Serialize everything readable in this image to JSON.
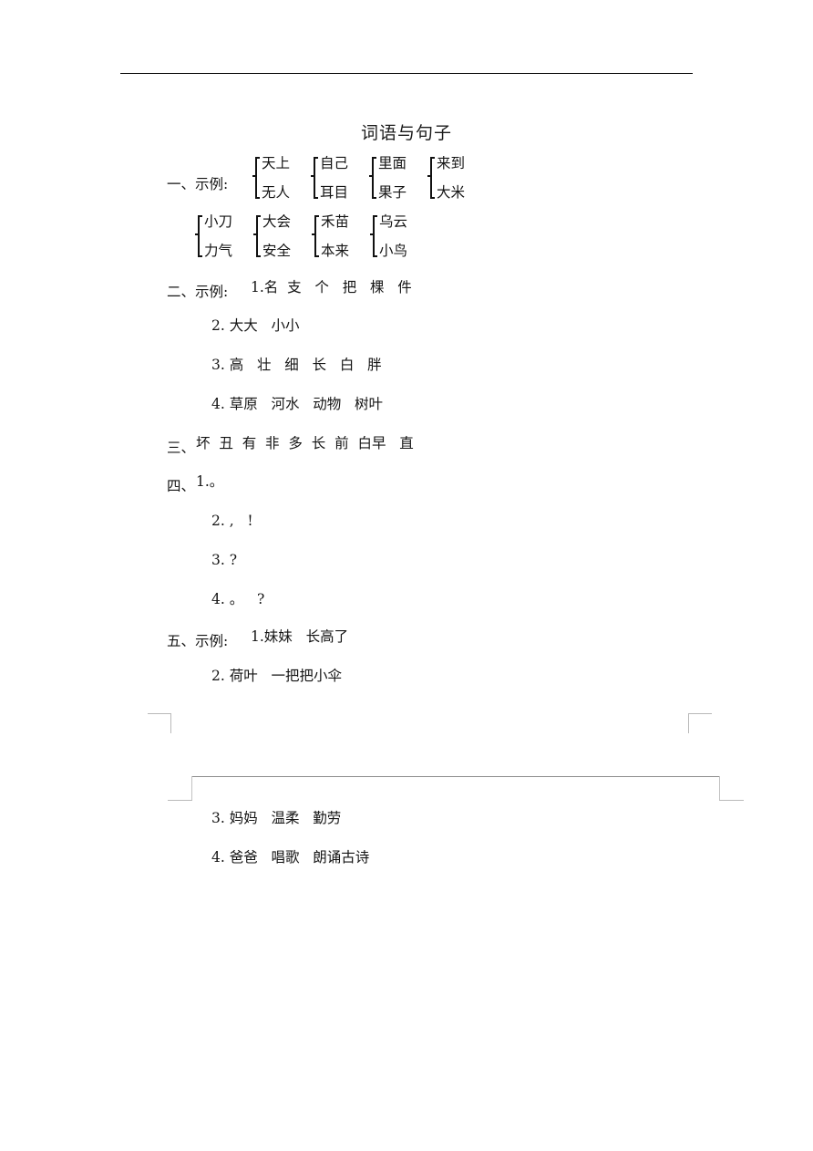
{
  "document": {
    "title": "词语与句子"
  },
  "sections": {
    "one": {
      "label": "一、示例:",
      "row1": [
        {
          "top": "天上",
          "bottom": "无人"
        },
        {
          "top": "自己",
          "bottom": "耳目"
        },
        {
          "top": "里面",
          "bottom": "果子"
        },
        {
          "top": "来到",
          "bottom": "大米"
        }
      ],
      "row2": [
        {
          "top": "小刀",
          "bottom": "力气"
        },
        {
          "top": "大会",
          "bottom": "安全"
        },
        {
          "top": "禾苗",
          "bottom": "本来"
        },
        {
          "top": "乌云",
          "bottom": "小鸟"
        }
      ]
    },
    "two": {
      "label": "二、示例:",
      "items": [
        "1.名  支   个   把   棵   件",
        "2. 大大   小小",
        "3. 高   壮   细   长   白   胖",
        "4. 草原   河水   动物   树叶"
      ]
    },
    "three": {
      "label": "三、",
      "answer": "坏  丑  有  非  多  长  前  白早   直"
    },
    "four": {
      "label": "四、",
      "items": [
        "1.。",
        "2. ,   !",
        "3. ?",
        "4. 。   ?"
      ]
    },
    "five": {
      "label": "五、示例:",
      "items": [
        "1.妹妹   长高了",
        "2. 荷叶   一把把小伞",
        "3. 妈妈   温柔   勤劳",
        "4. 爸爸   唱歌   朗诵古诗"
      ]
    }
  }
}
